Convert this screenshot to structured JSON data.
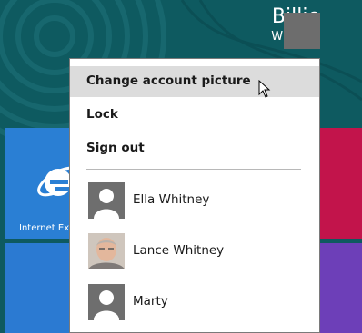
{
  "header": {
    "first_name": "Billie",
    "last_name": "Whitney",
    "avatar_icon": "user-silhouette-icon"
  },
  "start_tiles": {
    "internet_explorer_label": "Internet Ex"
  },
  "menu": {
    "items": [
      {
        "label": "Change account picture",
        "highlighted": true
      },
      {
        "label": "Lock"
      },
      {
        "label": "Sign out"
      }
    ],
    "users": [
      {
        "name": "Ella Whitney",
        "avatar": "user-silhouette-icon"
      },
      {
        "name": "Lance Whitney",
        "avatar": "user-photo"
      },
      {
        "name": "Marty",
        "avatar": "user-silhouette-icon"
      }
    ]
  },
  "colors": {
    "start_background": "#0e5a60",
    "menu_highlight": "#dcdcdc",
    "tile_blue": "#2a7fd4",
    "tile_red": "#c2144b",
    "tile_purple": "#6d3fb8"
  }
}
